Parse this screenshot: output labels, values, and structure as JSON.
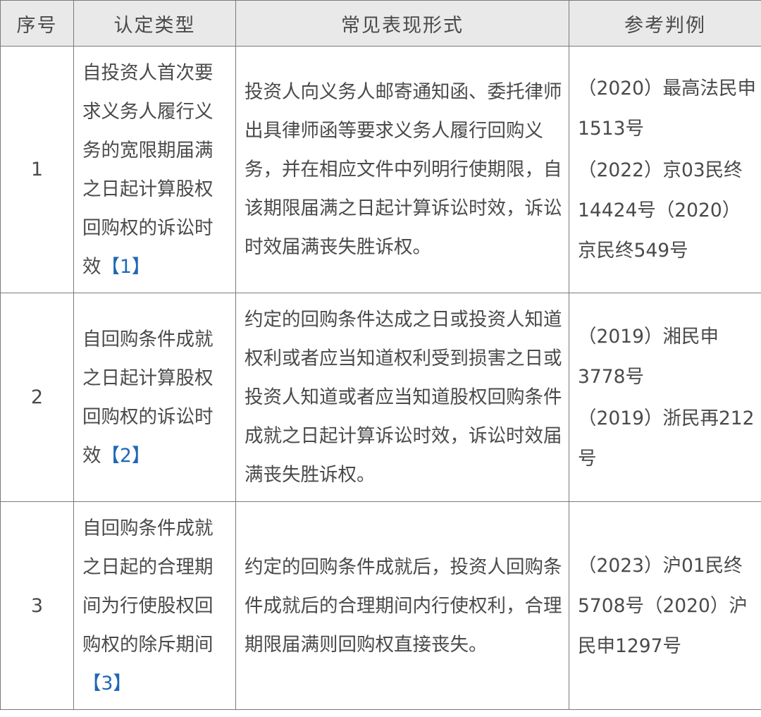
{
  "header": {
    "col_no": "序号",
    "col_type": "认定类型",
    "col_form": "常见表现形式",
    "col_ref": "参考判例"
  },
  "rows": [
    {
      "no": "1",
      "type": "自投资人首次要求义务人履行义务的宽限期届满之日起计算股权回购权的诉讼时效",
      "footnote": "【1】",
      "form": "投资人向义务人邮寄通知函、委托律师出具律师函等要求义务人履行回购义务，并在相应文件中列明行使期限，自该期限届满之日起计算诉讼时效，诉讼时效届满丧失胜诉权。",
      "refs": [
        "（2020）最高法民申1513号",
        "（2022）京03民终14424号（2020）京民终549号"
      ]
    },
    {
      "no": "2",
      "type": "自回购条件成就之日起计算股权回购权的诉讼时效",
      "footnote": "【2】",
      "form": "约定的回购条件达成之日或投资人知道权利或者应当知道权利受到损害之日或投资人知道或者应当知道股权回购条件成就之日起计算诉讼时效，诉讼时效届满丧失胜诉权。",
      "refs": [
        "（2019）湘民申3778号",
        "（2019）浙民再212号"
      ]
    },
    {
      "no": "3",
      "type": "自回购条件成就之日起的合理期间为行使股权回购权的除斥期间",
      "footnote": "【3】",
      "form": "约定的回购条件成就后，投资人回购条件成就后的合理期间内行使权利，合理期限届满则回购权直接丧失。",
      "refs": [
        "（2023）沪01民终5708号（2020）沪民申1297号"
      ]
    }
  ]
}
